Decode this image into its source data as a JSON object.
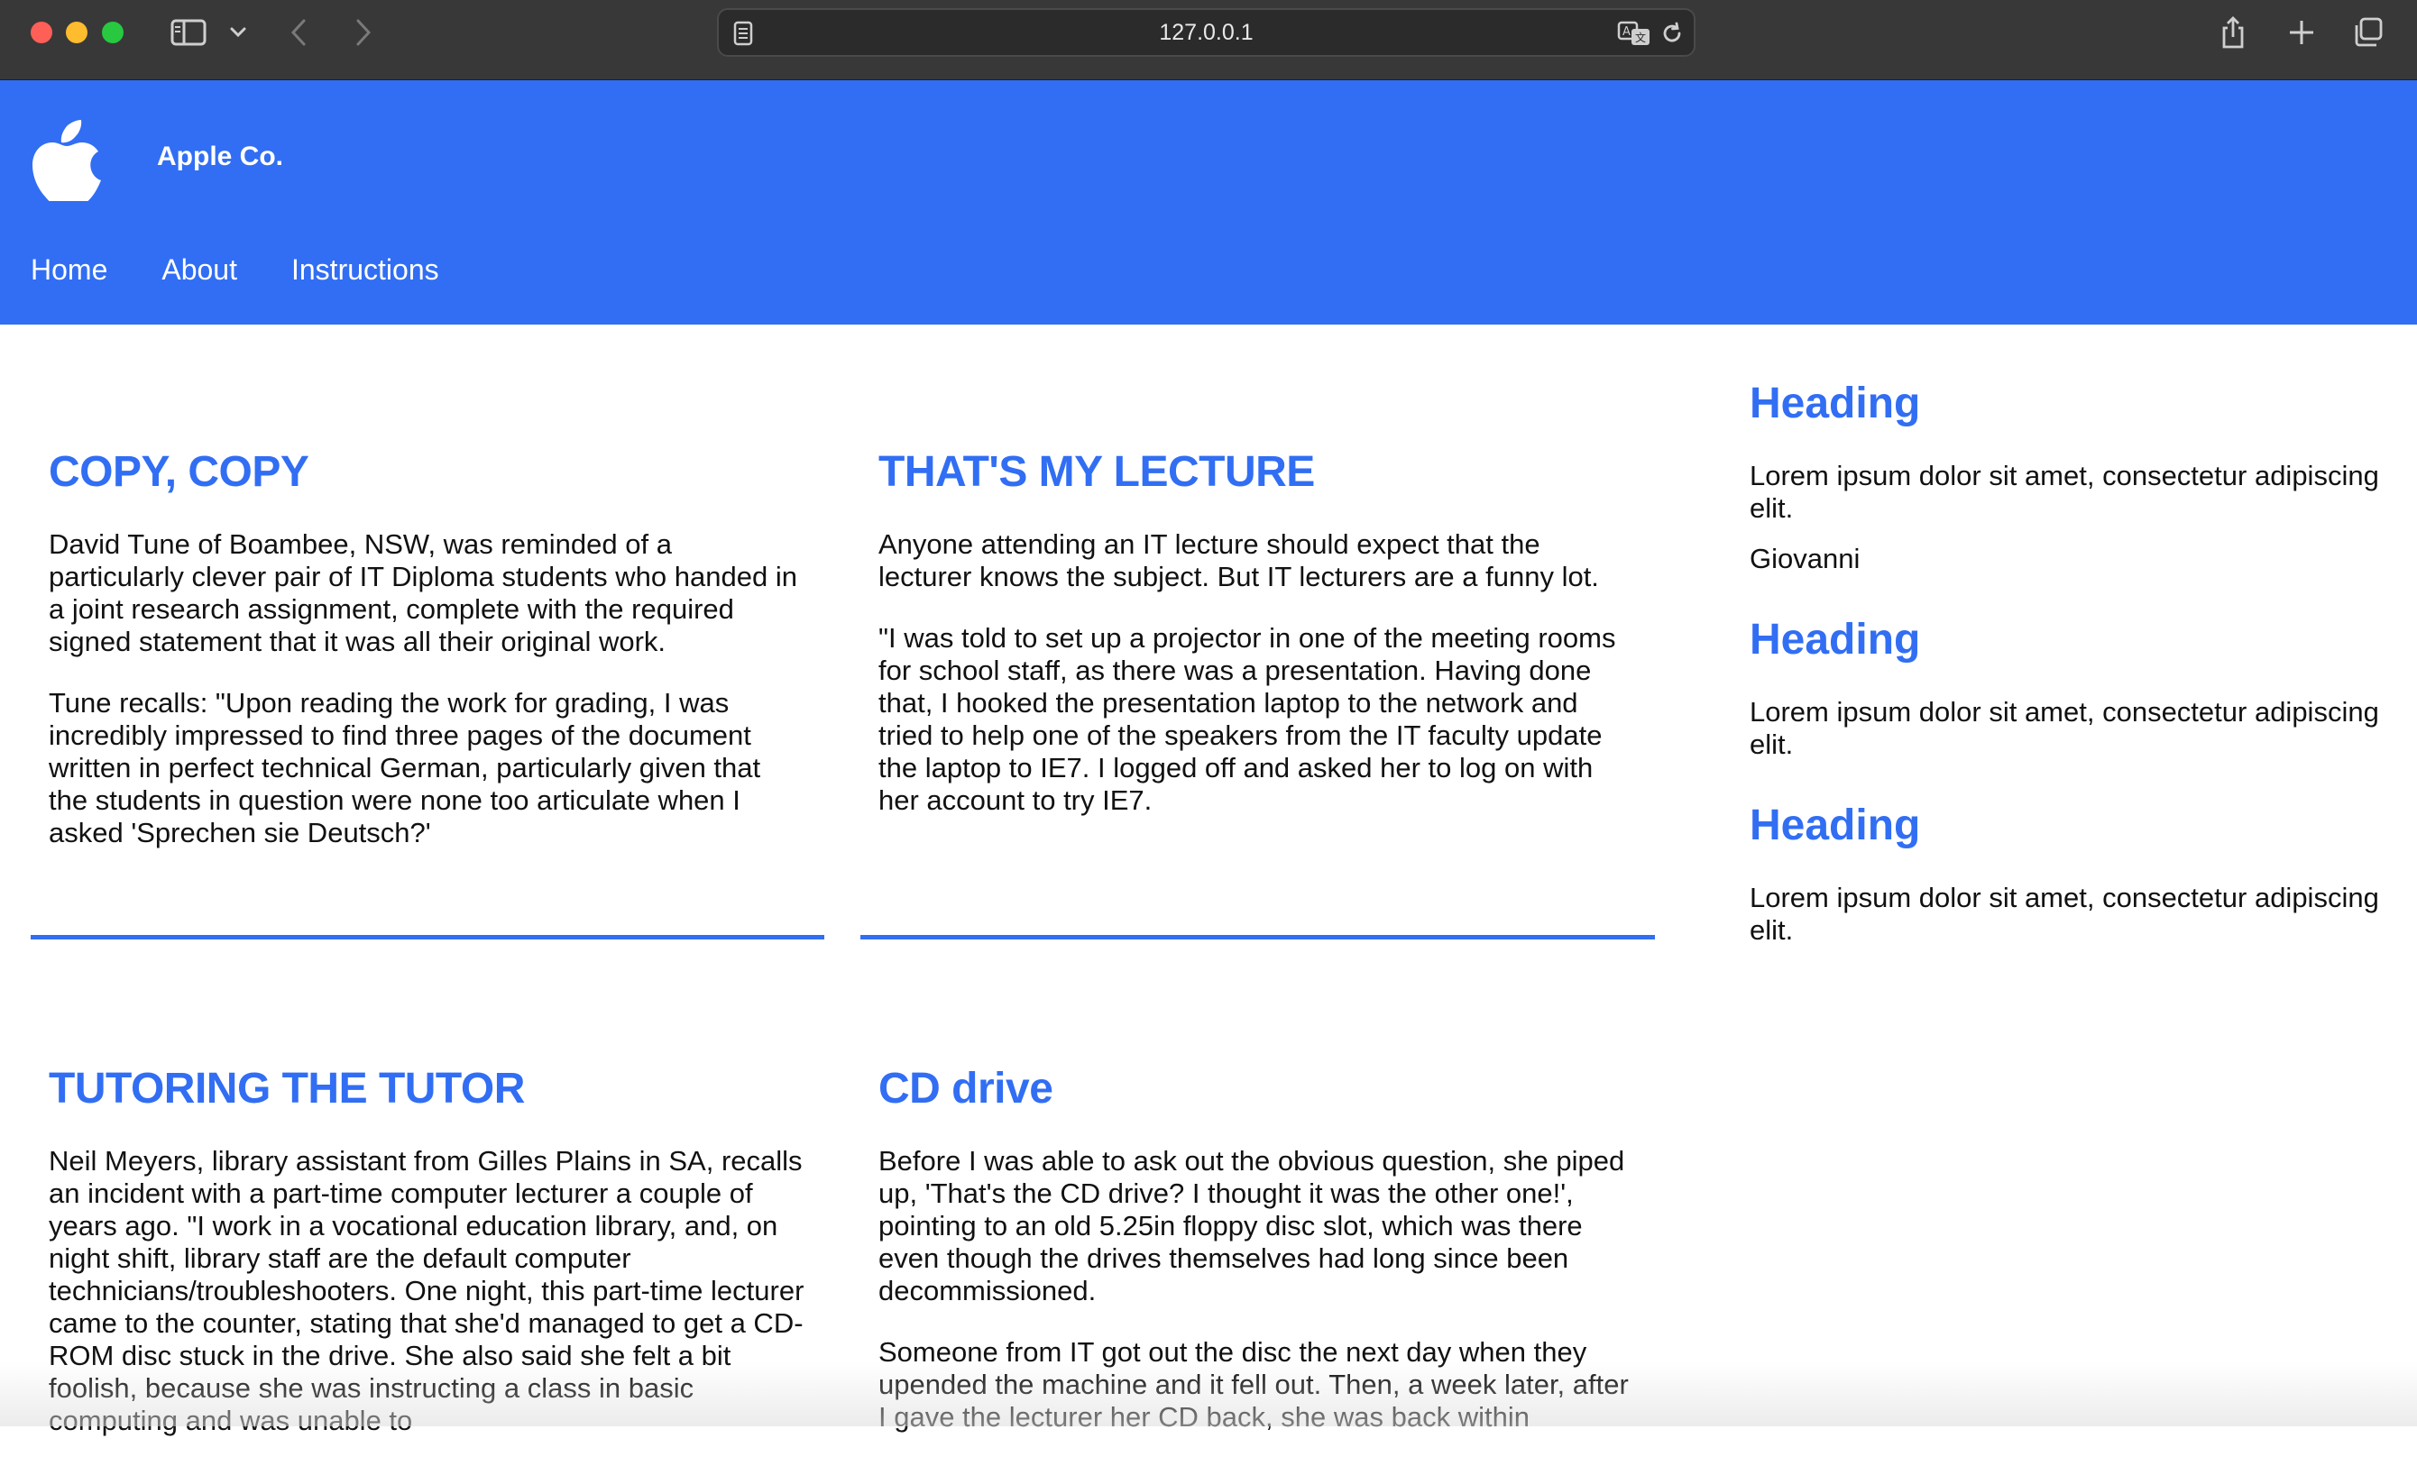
{
  "browser": {
    "url": "127.0.0.1",
    "icons": [
      "sidebar-icon",
      "chevron-down-icon",
      "back-icon",
      "forward-icon",
      "page-icon",
      "translate-icon",
      "reload-icon",
      "share-icon",
      "new-tab-icon",
      "tabs-overview-icon"
    ]
  },
  "header": {
    "brand": "Apple Co.",
    "logo_icon": "apple-logo-icon",
    "background": "#316ef3",
    "nav": [
      {
        "label": "Home"
      },
      {
        "label": "About"
      },
      {
        "label": "Instructions"
      }
    ]
  },
  "articles": [
    {
      "title": "COPY, COPY",
      "paragraphs": [
        "David Tune of Boambee, NSW, was reminded of a particularly clever pair of IT Diploma students who handed in a joint research assignment, complete with the required signed statement that it was all their original work.",
        "Tune recalls: \"Upon reading the work for grading, I was incredibly impressed to find three pages of the document written in perfect technical German, particularly given that the students in question were none too articulate when I asked 'Sprechen sie Deutsch?'"
      ]
    },
    {
      "title": "THAT'S MY LECTURE",
      "paragraphs": [
        "Anyone attending an IT lecture should expect that the lecturer knows the subject. But IT lecturers are a funny lot.",
        "\"I was told to set up a projector in one of the meeting rooms for school staff, as there was a presentation. Having done that, I hooked the presentation laptop to the network and tried to help one of the speakers from the IT faculty update the laptop to IE7. I logged off and asked her to log on with her account to try IE7."
      ]
    },
    {
      "title": "TUTORING THE TUTOR",
      "paragraphs": [
        "Neil Meyers, library assistant from Gilles Plains in SA, recalls an incident with a part-time computer lecturer a couple of years ago. \"I work in a vocational education library, and, on night shift, library staff are the default computer technicians/troubleshooters. One night, this part-time lecturer came to the counter, stating that she'd managed to get a CD-ROM disc stuck in the drive. She also said she felt a bit foolish, because she was instructing a class in basic computing and was unable to"
      ]
    },
    {
      "title": "CD drive",
      "paragraphs": [
        "Before I was able to ask out the obvious question, she piped up, 'That's the CD drive? I thought it was the other one!', pointing to an old 5.25in floppy disc slot, which was there even though the drives themselves had long since been decommissioned.",
        "Someone from IT got out the disc the next day when they upended the machine and it fell out. Then, a week later, after I gave the lecturer her CD back, she was back within"
      ]
    }
  ],
  "aside": [
    {
      "heading": "Heading",
      "paragraphs": [
        "Lorem ipsum dolor sit amet, consectetur adipiscing elit.",
        "Giovanni"
      ]
    },
    {
      "heading": "Heading",
      "paragraphs": [
        "Lorem ipsum dolor sit amet, consectetur adipiscing elit."
      ]
    },
    {
      "heading": "Heading",
      "paragraphs": [
        "Lorem ipsum dolor sit amet, consectetur adipiscing elit."
      ]
    }
  ]
}
